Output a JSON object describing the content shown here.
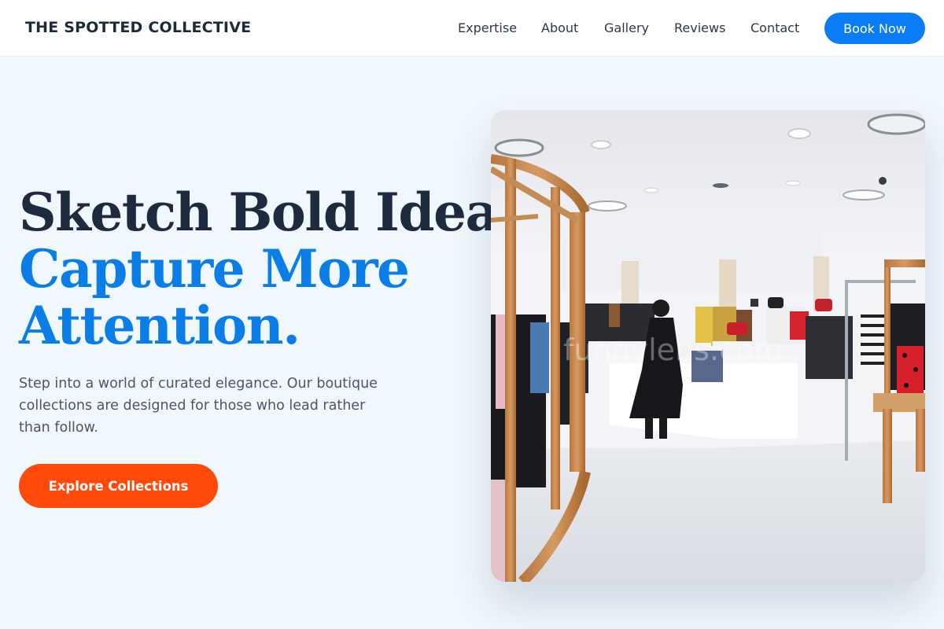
{
  "header": {
    "brand": "THE SPOTTED COLLECTIVE",
    "nav": [
      "Expertise",
      "About",
      "Gallery",
      "Reviews",
      "Contact"
    ],
    "book_label": "Book Now"
  },
  "hero": {
    "headline_line1": "Sketch Bold Ideas,",
    "headline_line2": "Capture More",
    "headline_line3": "Attention.",
    "description": "Step into a world of curated elegance. Our boutique collections are designed for those who lead rather than follow.",
    "cta_label": "Explore Collections",
    "image_watermark": "funnylens.com"
  },
  "colors": {
    "primary_blue": "#0a7cf5",
    "cta_orange": "#ff4a0c",
    "heading_dark": "#1e2b3f",
    "heading_accent": "#0a7ee6",
    "page_bg": "#f0f7fd"
  }
}
